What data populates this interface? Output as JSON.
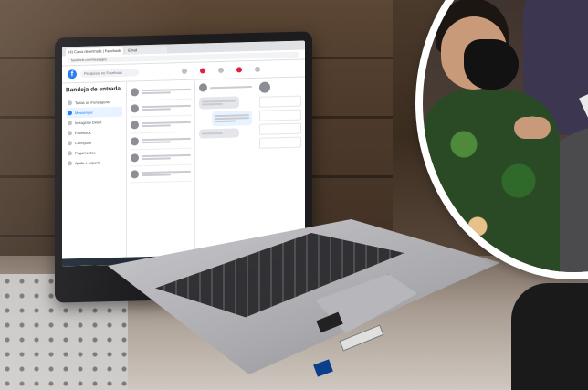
{
  "screen": {
    "browser_tab_1": "(4) Caixa de entrada | Facebook",
    "browser_tab_2": "Email",
    "address": "facebook.com/messages",
    "fb_logo_letter": "f",
    "fb_search_placeholder": "Pesquisar no Facebook",
    "inbox_title": "Bandeja de entrada",
    "sidebar_items": [
      "Todas as mensagens",
      "Messenger",
      "Instagram Direct",
      "Facebook",
      "Configurar",
      "Pagamentos",
      "Ajuda e suporte"
    ]
  },
  "colors": {
    "facebook_blue": "#1877f2",
    "notification_red": "#e41e3f"
  }
}
